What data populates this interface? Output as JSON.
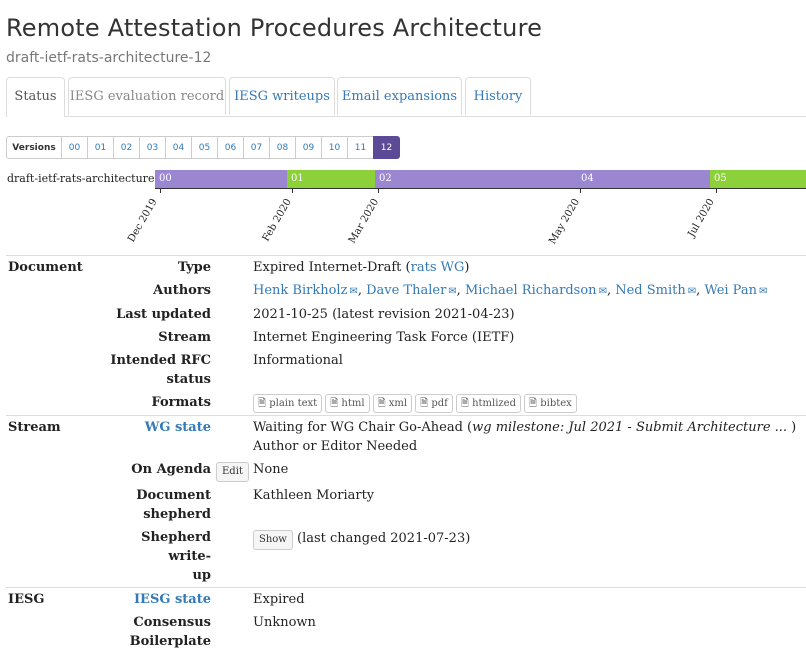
{
  "header": {
    "title": "Remote Attestation Procedures Architecture",
    "subtitle": "draft-ietf-rats-architecture-12"
  },
  "tabs": [
    "Status",
    "IESG evaluation record",
    "IESG writeups",
    "Email expansions",
    "History"
  ],
  "versions": {
    "label": "Versions",
    "items": [
      "00",
      "01",
      "02",
      "03",
      "04",
      "05",
      "06",
      "07",
      "08",
      "09",
      "10",
      "11",
      "12"
    ]
  },
  "timeline": {
    "draft_label": "draft-ietf-rats-architecture",
    "segments": [
      "00",
      "01",
      "02",
      "04",
      "05"
    ],
    "dates": [
      "Dec 2019",
      "Feb 2020",
      "Mar 2020",
      "May 2020",
      "Jul 2020"
    ],
    "colors": {
      "purple": "#9b86d1",
      "green": "#8cd03a"
    }
  },
  "document": {
    "section": "Document",
    "type_label": "Type",
    "type_value": "Expired Internet-Draft (",
    "type_link": "rats WG",
    "type_close": ")",
    "authors_label": "Authors",
    "authors": [
      "Henk Birkholz",
      "Dave Thaler",
      "Michael Richardson",
      "Ned Smith",
      "Wei Pan"
    ],
    "updated_label": "Last updated",
    "updated_value": "2021-10-25 (latest revision 2021-04-23)",
    "stream_label": "Stream",
    "stream_value": "Internet Engineering Task Force (IETF)",
    "rfc_label_1": "Intended RFC",
    "rfc_label_2": "status",
    "rfc_value": "Informational",
    "formats_label": "Formats",
    "formats": [
      "plain text",
      "html",
      "xml",
      "pdf",
      "htmlized",
      "bibtex"
    ]
  },
  "stream": {
    "section": "Stream",
    "wg_state_label": "WG state",
    "wg_state_value": "Waiting for WG Chair Go-Ahead (",
    "wg_milestone": "wg milestone: Jul 2021 - Submit Architecture ...",
    "wg_close": " )",
    "wg_state_value2": "Author or Editor Needed",
    "agenda_label": "On Agenda",
    "agenda_button": "Edit",
    "agenda_value": "None",
    "shepherd_label_1": "Document",
    "shepherd_label_2": "shepherd",
    "shepherd_value": "Kathleen Moriarty",
    "writeup_label_1": "Shepherd write-",
    "writeup_label_2": "up",
    "writeup_button": "Show",
    "writeup_value": "(last changed 2021-07-23)"
  },
  "iesg": {
    "section": "IESG",
    "state_label": "IESG state",
    "state_value": "Expired",
    "consensus_label_1": "Consensus",
    "consensus_label_2": "Boilerplate",
    "consensus_value": "Unknown"
  }
}
